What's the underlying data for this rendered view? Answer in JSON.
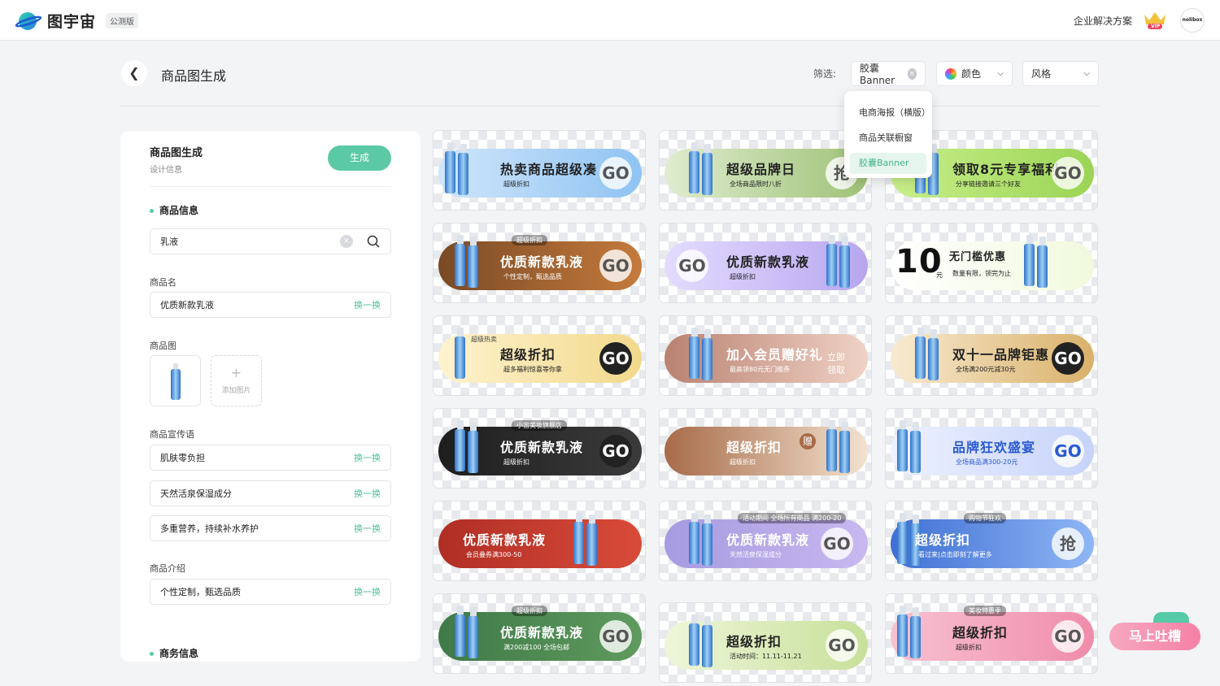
{
  "header": {
    "logo_text": "图宇宙",
    "badge": "公测版",
    "enterprise_link": "企业解决方案",
    "vip_label": "VIP",
    "avatar_text": "nolibox"
  },
  "page": {
    "title": "商品图生成"
  },
  "filters": {
    "label": "筛选:",
    "type_value": "胶囊Banner",
    "color_label": "颜色",
    "style_label": "风格"
  },
  "dropdown": {
    "options": [
      "电商海报（横版）",
      "商品关联橱窗",
      "胶囊Banner"
    ],
    "selected": "胶囊Banner"
  },
  "panel": {
    "title": "商品图生成",
    "subtitle": "设计信息",
    "generate_button": "生成",
    "product_info_heading": "商品信息",
    "search_value": "乳液",
    "name_label": "商品名",
    "name_value": "优质新款乳液",
    "swap_label": "换一换",
    "image_label": "商品图",
    "add_image_label": "添加图片",
    "slogan_label": "商品宣传语",
    "slogans": [
      "肌肤零负担",
      "天然活泉保湿成分",
      "多重营养，持续补水养护"
    ],
    "intro_label": "商品介绍",
    "intro_value": "个性定制，甄选品质",
    "business_heading": "商务信息"
  },
  "cards": [
    {
      "title": "热卖商品超级凑",
      "sub": "超级折扣",
      "go": "GO",
      "colors": [
        "#cfe6fb",
        "#8fc3f2"
      ]
    },
    {
      "title": "超级品牌日",
      "sub": "全场商品限时八折",
      "go": "抢",
      "colors": [
        "#dfeccf",
        "#9fc277"
      ]
    },
    {
      "title": "领取8元专享福利",
      "sub": "分享链接邀请三个好友",
      "go": "GO",
      "colors": [
        "#c8ef8a",
        "#9bd455"
      ]
    },
    {
      "title": "优质新款乳液",
      "sub": "个性定制，甄选品质",
      "tag": "超级折扣",
      "go": "GO",
      "colors": [
        "#7a4a26",
        "#c57a3c"
      ]
    },
    {
      "title": "优质新款乳液",
      "sub": "超级折扣",
      "go": "GO",
      "colors": [
        "#e4dcff",
        "#b7a6ef"
      ]
    },
    {
      "title": "无门槛优惠",
      "big": "10",
      "unit": "元",
      "sub": "数量有限，领完为止",
      "go": "",
      "colors": [
        "#ffffff",
        "#f1f9dd"
      ]
    },
    {
      "title": "超级折扣",
      "sub": "超多福利惊喜等你拿",
      "tag": "超级热卖",
      "go": "GO",
      "colors": [
        "#fff3cf",
        "#f1d98b"
      ]
    },
    {
      "title": "加入会员赠好礼",
      "sub": "最高领80元无门槛券",
      "cta": "立即领取",
      "go": "",
      "colors": [
        "#b98271",
        "#efd2c6"
      ]
    },
    {
      "title": "双十一品牌钜惠",
      "sub": "全场满200元减30元",
      "go": "GO",
      "colors": [
        "#f8ead0",
        "#d9b16a"
      ]
    },
    {
      "title": "优质新款乳液",
      "sub": "超级折扣",
      "tag": "小宙美妆旗舰店",
      "go": "GO",
      "colors": [
        "#1e1e1e",
        "#3b3b3b"
      ]
    },
    {
      "title": "超级折扣",
      "sub": "超级折扣",
      "badge": "赠",
      "go": "",
      "colors": [
        "#a76b49",
        "#f3e2cf"
      ]
    },
    {
      "title": "品牌狂欢盛宴",
      "sub": "全场商品满300-20元",
      "go": "GO",
      "colors": [
        "#eef2ff",
        "#c6d3fa"
      ]
    },
    {
      "title": "优质新款乳液",
      "sub": "会员叠券满300-50",
      "go": "",
      "colors": [
        "#b02e25",
        "#d94b3a"
      ]
    },
    {
      "title": "优质新款乳液",
      "sub": "天然活泉保湿成分",
      "tag": "活动期间 全场所有商品 满200-20",
      "go": "GO",
      "colors": [
        "#a69be0",
        "#c9b8f0"
      ]
    },
    {
      "title": "超级折扣",
      "sub": "看过来|点击即刻了解更多",
      "tag": "购物节狂欢",
      "go": "抢",
      "colors": [
        "#3f6fd3",
        "#8fb6f5"
      ]
    },
    {
      "title": "优质新款乳液",
      "sub": "满200减100 全场包邮",
      "tag": "超级折扣",
      "go": "GO",
      "colors": [
        "#3f7a48",
        "#5f9a5e"
      ]
    },
    {
      "title": "超级折扣",
      "sub": "活动时间：11.11-11.21",
      "go": "GO",
      "colors": [
        "#eef6d9",
        "#c8e09a"
      ]
    },
    {
      "title": "超级折扣",
      "sub": "超级折扣",
      "tag": "美妆特惠季",
      "go": "GO",
      "colors": [
        "#f7c2d1",
        "#f08cab"
      ]
    }
  ],
  "feedback": {
    "label": "马上吐槽"
  }
}
